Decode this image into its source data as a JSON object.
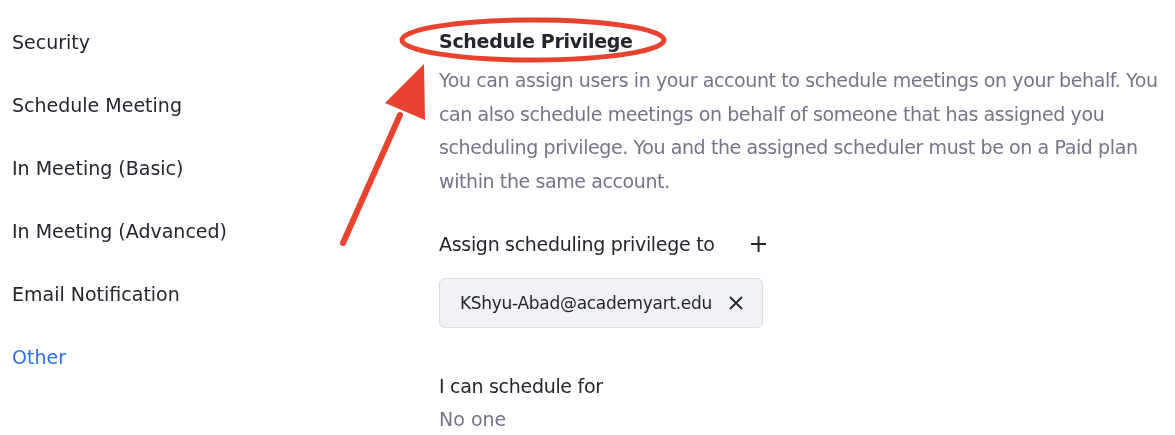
{
  "sidebar": {
    "items": [
      {
        "label": "Security",
        "selected": false
      },
      {
        "label": "Schedule Meeting",
        "selected": false
      },
      {
        "label": "In Meeting (Basic)",
        "selected": false
      },
      {
        "label": "In Meeting (Advanced)",
        "selected": false
      },
      {
        "label": "Email Notification",
        "selected": false
      },
      {
        "label": "Other",
        "selected": true
      }
    ]
  },
  "section": {
    "title": "Schedule Privilege",
    "description": "You can assign users in your account to schedule meetings on your behalf. You can also schedule meetings on behalf of someone that has assigned you scheduling privilege. You and the assigned scheduler must be on a Paid plan within the same account.",
    "assign_label": "Assign scheduling privilege to",
    "add_symbol": "+",
    "assignees": [
      {
        "email": "KShyu-Abad@academyart.edu"
      }
    ],
    "schedule_for_label": "I can schedule for",
    "schedule_for_value": "No one"
  }
}
